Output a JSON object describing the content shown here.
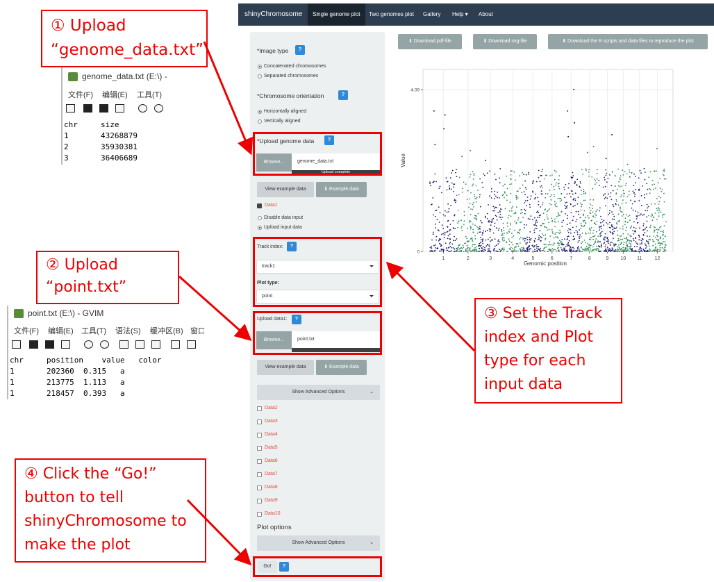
{
  "navbar": {
    "brand": "shinyChromosome",
    "items": [
      "Single genome plot",
      "Two genomes plot",
      "Gallery",
      "Help ▾",
      "About"
    ]
  },
  "download": {
    "pdf": "⬇ Download pdf-file",
    "svg": "⬇ Download svg-file",
    "scripts": "⬇ Download the R scripts and data files to reproduce the plot"
  },
  "sidebar": {
    "image_type_label": "*Image type",
    "image_type_options": [
      "Concatenated chromosomes",
      "Separated chromosomes"
    ],
    "orientation_label": "*Chromosome orientation",
    "orientation_options": [
      "Horizontally aligned",
      "Vertically aligned"
    ],
    "upload_genome_label": "*Upload genome data",
    "browse_label": "Browse...",
    "genome_file": "genome_data.txt",
    "upload_complete": "Upload complete",
    "view_example": "View example data",
    "example_data": "⬇ Example data",
    "data1_label": "Data1",
    "data_input_options": [
      "Disable data input",
      "Upload input data"
    ],
    "track_index_label": "Track index:",
    "track_value": "track1",
    "plot_type_label": "Plot type:",
    "plot_type_value": "point",
    "upload_data1_label": "Upload data1:",
    "point_file": "point.txt",
    "advanced": "Show Advanced Options",
    "data_items": [
      "Data2",
      "Data3",
      "Data4",
      "Data5",
      "Data6",
      "Data7",
      "Data8",
      "Data9",
      "Data10"
    ],
    "plot_options": "Plot options",
    "go": "Go!",
    "help": "?"
  },
  "callouts": {
    "c1": [
      "① Upload",
      "“genome_data.txt”"
    ],
    "c2": [
      "② Upload",
      "“point.txt”"
    ],
    "c3": [
      "③ Set the Track",
      "index and Plot",
      "type for each",
      "input data"
    ],
    "c4": [
      "④ Click the “Go!”",
      "button to tell",
      "shinyChromosome to",
      "make the plot"
    ]
  },
  "gvim1": {
    "title": "genome_data.txt (E:\\) -",
    "menu": [
      "文件(F)",
      "编辑(E)",
      "工具(T)"
    ],
    "lines": [
      "chr     size",
      "1       43268879",
      "2       35930381",
      "3       36406689"
    ]
  },
  "gvim2": {
    "title": "point.txt (E:\\) - GVIM",
    "menu": [
      "文件(F)",
      "编辑(E)",
      "工具(T)",
      "语法(S)",
      "缓冲区(B)",
      "窗口"
    ],
    "lines": [
      "chr     position    value   color",
      "1       202360  0.315   a",
      "1       213775  1.113   a",
      "1       218457  0.393   a"
    ]
  },
  "chart_data": {
    "type": "scatter",
    "xlabel": "Genomic position",
    "ylabel": "Value",
    "x_ticks": [
      "1",
      "2",
      "3",
      "4",
      "5",
      "6",
      "7",
      "8",
      "9",
      "10",
      "11",
      "12"
    ],
    "y_ticks": [
      "0",
      "4.09"
    ],
    "ylim": [
      0,
      4.6
    ],
    "colors": [
      "#191970",
      "#2e8b57"
    ],
    "outliers": [
      {
        "chr": "1",
        "value": 3.55
      },
      {
        "chr": "1",
        "value": 3.1
      },
      {
        "chr": "1",
        "value": 2.7
      },
      {
        "chr": "1",
        "value": 3.45
      },
      {
        "chr": "2",
        "value": 2.4
      },
      {
        "chr": "2",
        "value": 2.55
      },
      {
        "chr": "3",
        "value": 2.3
      },
      {
        "chr": "7",
        "value": 4.09
      },
      {
        "chr": "7",
        "value": 3.55
      },
      {
        "chr": "7",
        "value": 3.25
      },
      {
        "chr": "7",
        "value": 2.9
      },
      {
        "chr": "8",
        "value": 2.65
      },
      {
        "chr": "8",
        "value": 2.5
      },
      {
        "chr": "9",
        "value": 2.95
      },
      {
        "chr": "9",
        "value": 2.35
      },
      {
        "chr": "10",
        "value": 2.2
      },
      {
        "chr": "12",
        "value": 2.6
      }
    ]
  }
}
